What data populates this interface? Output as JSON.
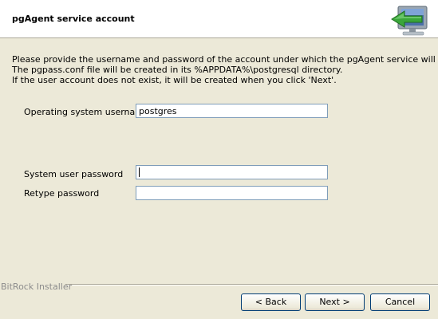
{
  "header": {
    "title": "pgAgent service account",
    "icon": "computer-arrow-icon"
  },
  "description": {
    "lines": [
      "Please provide the username and password of the account under which the pgAgent service will run.",
      "The pgpass.conf file will be created in its %APPDATA%\\postgresql directory.",
      "If the user account does not exist, it will be created when you click 'Next'."
    ]
  },
  "form": {
    "username": {
      "label": "Operating system username",
      "value": "postgres"
    },
    "password": {
      "label": "System user password",
      "value": ""
    },
    "retype": {
      "label": "Retype password",
      "value": ""
    }
  },
  "footer": {
    "brand": "BitRock Installer",
    "back_label": "< Back",
    "next_label": "Next >",
    "cancel_label": "Cancel"
  },
  "colors": {
    "dialog_background": "#ece9d8",
    "header_background": "#ffffff",
    "input_border": "#7f9db9",
    "button_border": "#003c74",
    "arrow_green": "#3aa63a"
  }
}
